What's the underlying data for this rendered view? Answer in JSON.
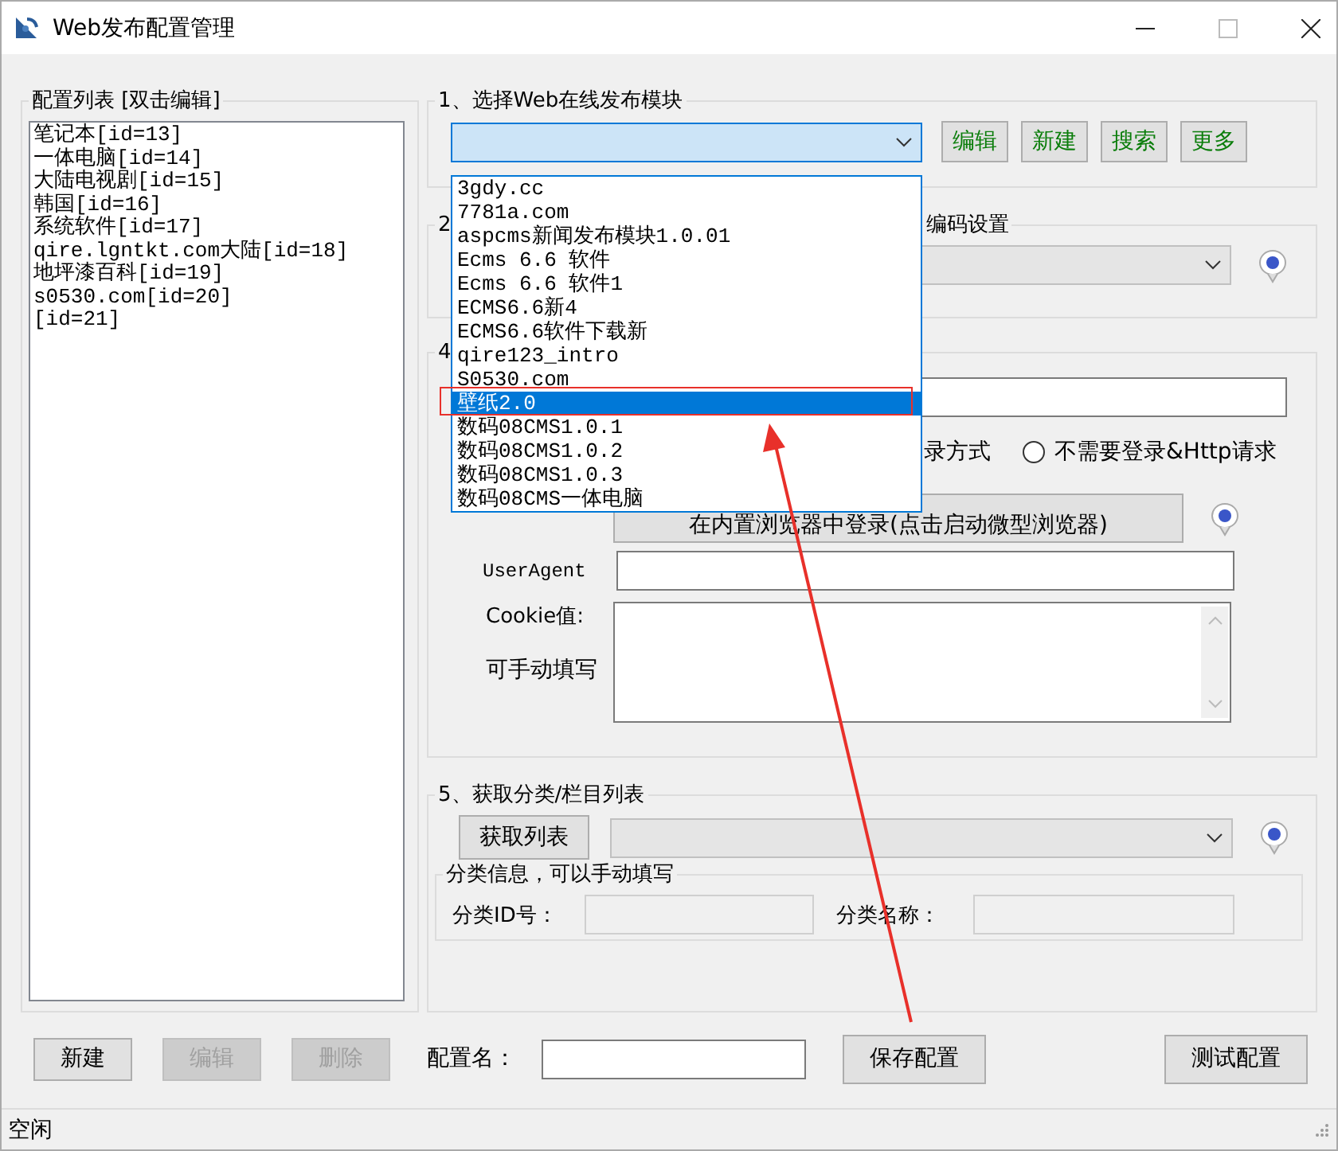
{
  "window": {
    "title": "Web发布配置管理"
  },
  "config_list": {
    "title": "配置列表  [双击编辑]",
    "items": [
      "笔记本[id=13]",
      "一体电脑[id=14]",
      "大陆电视剧[id=15]",
      "韩国[id=16]",
      "系统软件[id=17]",
      "qire.lgntkt.com大陆[id=18]",
      "地坪漆百科[id=19]",
      "s0530.com[id=20]",
      "[id=21]"
    ]
  },
  "section1": {
    "title": "1、选择Web在线发布模块",
    "dropdown": {
      "open": true,
      "options": [
        {
          "label": "3gdy.cc",
          "selected": false
        },
        {
          "label": "7781a.com",
          "selected": false
        },
        {
          "label": "aspcms新闻发布模块1.0.01",
          "selected": false
        },
        {
          "label": "Ecms 6.6 软件",
          "selected": false
        },
        {
          "label": "Ecms 6.6 软件1",
          "selected": false
        },
        {
          "label": "ECMS6.6新4",
          "selected": false
        },
        {
          "label": "ECMS6.6软件下载新",
          "selected": false
        },
        {
          "label": "qire123_intro",
          "selected": false
        },
        {
          "label": "S0530.com",
          "selected": false
        },
        {
          "label": "壁纸2.0",
          "selected": true
        },
        {
          "label": "数码08CMS1.0.1",
          "selected": false
        },
        {
          "label": "数码08CMS1.0.2",
          "selected": false
        },
        {
          "label": "数码08CMS1.0.3",
          "selected": false
        },
        {
          "label": "数码08CMS一体电脑",
          "selected": false
        }
      ]
    },
    "buttons": [
      "编辑",
      "新建",
      "搜索",
      "更多"
    ]
  },
  "section2": {
    "title": "2",
    "title_tail": "编码设置"
  },
  "section4": {
    "title": "4",
    "radio_label_tail": "录方式",
    "radio": {
      "label": "不需要登录&Http请求",
      "selected": false
    },
    "login_button": "在内置浏览器中登录(点击启动微型浏览器)",
    "useragent_label": "UserAgent",
    "cookie_label": "Cookie值:",
    "cookie_hint": "可手动填写"
  },
  "section5": {
    "title": "5、获取分类/栏目列表",
    "fetch_button": "获取列表",
    "category_info": {
      "title": "分类信息，可以手动填写",
      "id_label": "分类ID号：",
      "name_label": "分类名称："
    }
  },
  "bottom": {
    "buttons": [
      {
        "label": "新建",
        "disabled": false
      },
      {
        "label": "编辑",
        "disabled": true
      },
      {
        "label": "删除",
        "disabled": true
      }
    ],
    "name_label": "配置名：",
    "save_button": "保存配置",
    "test_button": "测试配置"
  },
  "status_bar": "空闲"
}
